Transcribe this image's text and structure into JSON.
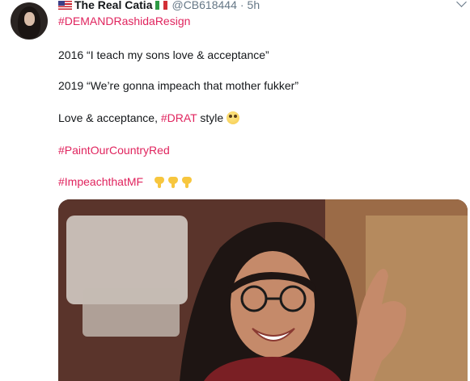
{
  "tweet": {
    "author_name": "The Real Catia",
    "handle": "@CB618444",
    "separator": "·",
    "time": "5h",
    "hashtag_top": "#DEMANDRashidaResign",
    "line_2016": "2016  “I teach my sons love & acceptance”",
    "line_2019": "2019 “We’re gonna impeach that mother fukker”",
    "love_text": "Love & acceptance, ",
    "love_hashtag": "#DRAT",
    "love_suffix": " style",
    "hashtag_paint": "#PaintOurCountryRed",
    "hashtag_impeach": "#ImpeachthatMF",
    "emoji_roll": "face-with-rolling-eyes",
    "emoji_point": "backhand-index-pointing-down"
  },
  "colors": {
    "hashtag": "#e0245e",
    "text": "#14171a",
    "muted": "#657786"
  }
}
